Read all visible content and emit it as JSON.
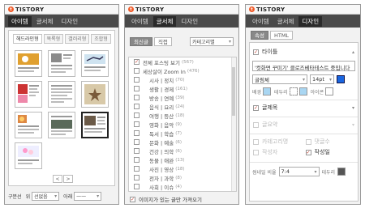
{
  "logo_text": "TISTORY",
  "main_tabs": [
    "아이템",
    "글서체",
    "디자인"
  ],
  "panel1": {
    "active_tab_index": 0,
    "subtabs": [
      "헤드라인형",
      "목록형",
      "갤러리형",
      "조합형"
    ],
    "thumbnail_count": 10,
    "selected_thumb_index": 8,
    "pager": [
      "<",
      ">"
    ],
    "bottom": {
      "label1": "구분선",
      "label2": "위",
      "value1": "선없음",
      "label3": "아래",
      "value2": "——"
    }
  },
  "panel2": {
    "active_tab_index": 1,
    "subtabs": [
      "최신글",
      "직접"
    ],
    "category_select": "카테고리별",
    "items": [
      {
        "label": "전체 포스팅 보기",
        "count": "(567)",
        "checked": true,
        "indent": false
      },
      {
        "label": "세상살이 Zoom In",
        "count": "(476)",
        "checked": false,
        "indent": false
      },
      {
        "label": "시사 | 정치",
        "count": "(70)",
        "checked": false,
        "indent": true
      },
      {
        "label": "생활 | 경제",
        "count": "(161)",
        "checked": false,
        "indent": true
      },
      {
        "label": "방송 | 연예",
        "count": "(39)",
        "checked": false,
        "indent": true
      },
      {
        "label": "음식 | 요리",
        "count": "(24)",
        "checked": false,
        "indent": true
      },
      {
        "label": "여행 | 등산",
        "count": "(18)",
        "checked": false,
        "indent": true
      },
      {
        "label": "영화 | 음악",
        "count": "(9)",
        "checked": false,
        "indent": true
      },
      {
        "label": "독서 | 학습",
        "count": "(7)",
        "checked": false,
        "indent": true
      },
      {
        "label": "문화 | 예술",
        "count": "(6)",
        "checked": false,
        "indent": true
      },
      {
        "label": "건강 | 의학",
        "count": "(6)",
        "checked": false,
        "indent": true
      },
      {
        "label": "동물 | 애완",
        "count": "(13)",
        "checked": false,
        "indent": true
      },
      {
        "label": "사진 | 영상",
        "count": "(18)",
        "checked": false,
        "indent": true
      },
      {
        "label": "전자 | 과학",
        "count": "(8)",
        "checked": false,
        "indent": true
      },
      {
        "label": "사회 | 이슈",
        "count": "(4)",
        "checked": false,
        "indent": true
      }
    ],
    "footer_label": "이미지가 있는 글만 가져오기",
    "footer_checked": true
  },
  "panel3": {
    "active_tab_index": 2,
    "subtabs": [
      "속성",
      "HTML"
    ],
    "title_section": "타이틀",
    "title_value": "'컷화면 꾸미기' 클로즈베타테스트 중입니다",
    "font_value": "굴림체",
    "size_value": "14pt",
    "bg_label": "배경",
    "border_label": "테두리",
    "icon_label": "아이콘",
    "summary_label": "글제목",
    "summary2_label": "글요약",
    "cat_label": "카테고리명",
    "comment_label": "댓글수",
    "writer_label": "작성자",
    "date_label": "작성일",
    "ratio_label": "썸네일 비율",
    "ratio_value": "7:4",
    "border2_label": "테두리",
    "accent": "#1a66e0",
    "swatch_light": "#a9d6f2"
  }
}
